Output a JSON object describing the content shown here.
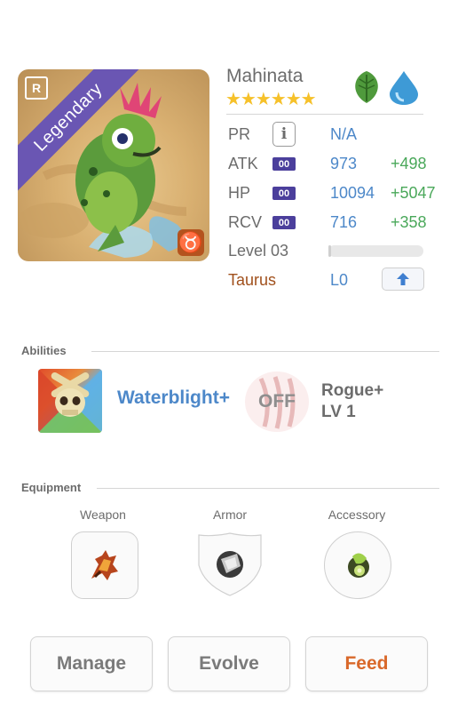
{
  "monster": {
    "name": "Mahinata",
    "rarity": "Legendary",
    "rarity_badge": "R",
    "stars": "★★★★★★",
    "star_count": 6,
    "zodiac_symbol": "♉",
    "elements": [
      "leaf-element-icon",
      "water-element-icon"
    ]
  },
  "stats": {
    "pr": {
      "label": "PR",
      "info": "i",
      "value": "N/A"
    },
    "atk": {
      "label": "ATK",
      "tag": "00",
      "value": "973",
      "bonus": "+498"
    },
    "hp": {
      "label": "HP",
      "tag": "00",
      "value": "10094",
      "bonus": "+5047"
    },
    "rcv": {
      "label": "RCV",
      "tag": "00",
      "value": "716",
      "bonus": "+358"
    },
    "level": {
      "label": "Level 03",
      "progress": 0.03
    },
    "zodiac": {
      "label": "Taurus",
      "value": "L0"
    }
  },
  "abilities": {
    "title": "Abilities",
    "active": {
      "name": "Waterblight+"
    },
    "passive": {
      "status": "OFF",
      "name": "Rogue+",
      "level": "LV 1"
    }
  },
  "equipment": {
    "title": "Equipment",
    "slots": [
      {
        "label": "Weapon",
        "icon": "weapon-icon"
      },
      {
        "label": "Armor",
        "icon": "armor-icon"
      },
      {
        "label": "Accessory",
        "icon": "accessory-icon"
      }
    ]
  },
  "actions": {
    "manage": "Manage",
    "evolve": "Evolve",
    "feed": "Feed"
  },
  "colors": {
    "legendary": "#6a56b3",
    "value_blue": "#4d88c9",
    "bonus_green": "#4aa85a",
    "zodiac_brown": "#a0501c",
    "feed_orange": "#d9682a"
  }
}
